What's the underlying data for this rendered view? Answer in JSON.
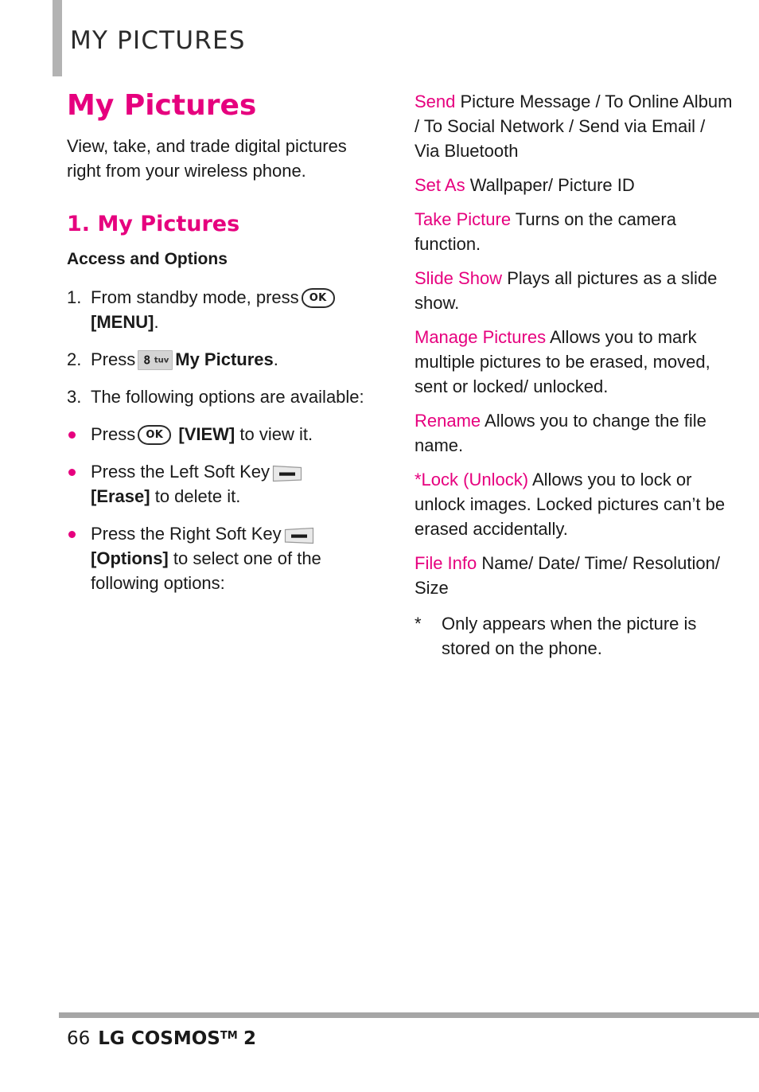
{
  "header": {
    "running_title": "MY PICTURES"
  },
  "left_column": {
    "heading": "My Pictures",
    "intro": "View, take, and trade digital pictures right from your wireless phone.",
    "section_heading": "1. My Pictures",
    "subsection_heading": "Access and Options",
    "steps": [
      {
        "num": "1.",
        "text_before": "From standby mode, press",
        "icon": "ok-key-icon",
        "icon_label": "OK",
        "text_after_bold": "[MENU]",
        "text_tail": "."
      },
      {
        "num": "2.",
        "text_before": "Press",
        "icon": "number-key-8-icon",
        "icon_digit": "8",
        "icon_letters": "tuv",
        "text_after_bold": "My Pictures",
        "text_tail": "."
      },
      {
        "num": "3.",
        "text_before": "The following options are available:",
        "icon": "",
        "icon_label": "",
        "text_after_bold": "",
        "text_tail": ""
      }
    ],
    "bullets": [
      {
        "text_before": "Press",
        "icon": "ok-key-icon",
        "icon_label": "OK",
        "bold_text": "[VIEW]",
        "text_after": "to view it."
      },
      {
        "text_before": "Press the Left Soft Key",
        "icon": "left-soft-key-icon",
        "icon_label": "",
        "bold_text": "[Erase]",
        "text_after": "to delete it."
      },
      {
        "text_before": "Press the Right Soft Key",
        "icon": "right-soft-key-icon",
        "icon_label": "",
        "bold_text": "[Options]",
        "text_after": "to select one of the following options:"
      }
    ]
  },
  "right_column": {
    "options": [
      {
        "term": "Send",
        "desc": " Picture Message / To Online Album / To Social Network / Send via Email / Via Bluetooth"
      },
      {
        "term": "Set As",
        "desc": " Wallpaper/ Picture ID"
      },
      {
        "term": "Take Picture",
        "desc": " Turns on the camera function."
      },
      {
        "term": "Slide Show",
        "desc": " Plays all pictures as a slide show."
      },
      {
        "term": "Manage Pictures",
        "desc": " Allows you to mark multiple pictures to be erased, moved, sent or locked/ unlocked."
      },
      {
        "term": "Rename",
        "desc": " Allows you to change the file name."
      },
      {
        "term": "*Lock (Unlock)",
        "desc": " Allows you to lock or unlock images. Locked pictures can’t be erased accidentally."
      },
      {
        "term": "File Info",
        "desc": " Name/ Date/ Time/ Resolution/ Size"
      }
    ],
    "footnote": {
      "marker": "*",
      "text": "Only appears when the picture is stored on the phone."
    }
  },
  "footer": {
    "page_number": "66",
    "brand": "LG COSMOS",
    "trademark": "TM",
    "model": "2"
  },
  "colors": {
    "accent_magenta": "#e6007e",
    "header_bar_gray": "#b3b3b3",
    "footer_rule_gray": "#a6a6a6",
    "body_text": "#1a1a1a"
  }
}
